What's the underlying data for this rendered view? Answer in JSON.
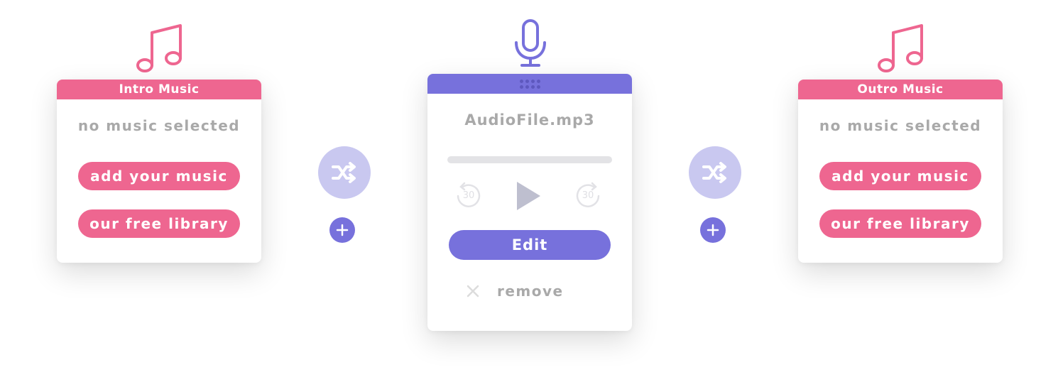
{
  "colors": {
    "pink": "#ee6690",
    "purple": "#7771dc",
    "shuffle_bg": "#c9c8f0",
    "muted_text": "#a9a9a9"
  },
  "intro": {
    "icon": "music-note-icon",
    "title": "Intro Music",
    "status": "no music selected",
    "add_button": "add your music",
    "library_button": "our free library"
  },
  "transition_left": {
    "shuffle_icon": "shuffle-icon",
    "add_icon": "plus-icon"
  },
  "main_audio": {
    "icon": "microphone-icon",
    "drag_handle_icon": "grip-icon",
    "filename": "AudioFile.mp3",
    "progress": 0,
    "rewind_label": "30",
    "forward_label": "30",
    "play_icon": "play-icon",
    "edit_button": "Edit",
    "remove_label": "remove",
    "remove_icon": "close-icon"
  },
  "transition_right": {
    "shuffle_icon": "shuffle-icon",
    "add_icon": "plus-icon"
  },
  "outro": {
    "icon": "music-note-icon",
    "title": "Outro Music",
    "status": "no music selected",
    "add_button": "add your music",
    "library_button": "our free library"
  }
}
